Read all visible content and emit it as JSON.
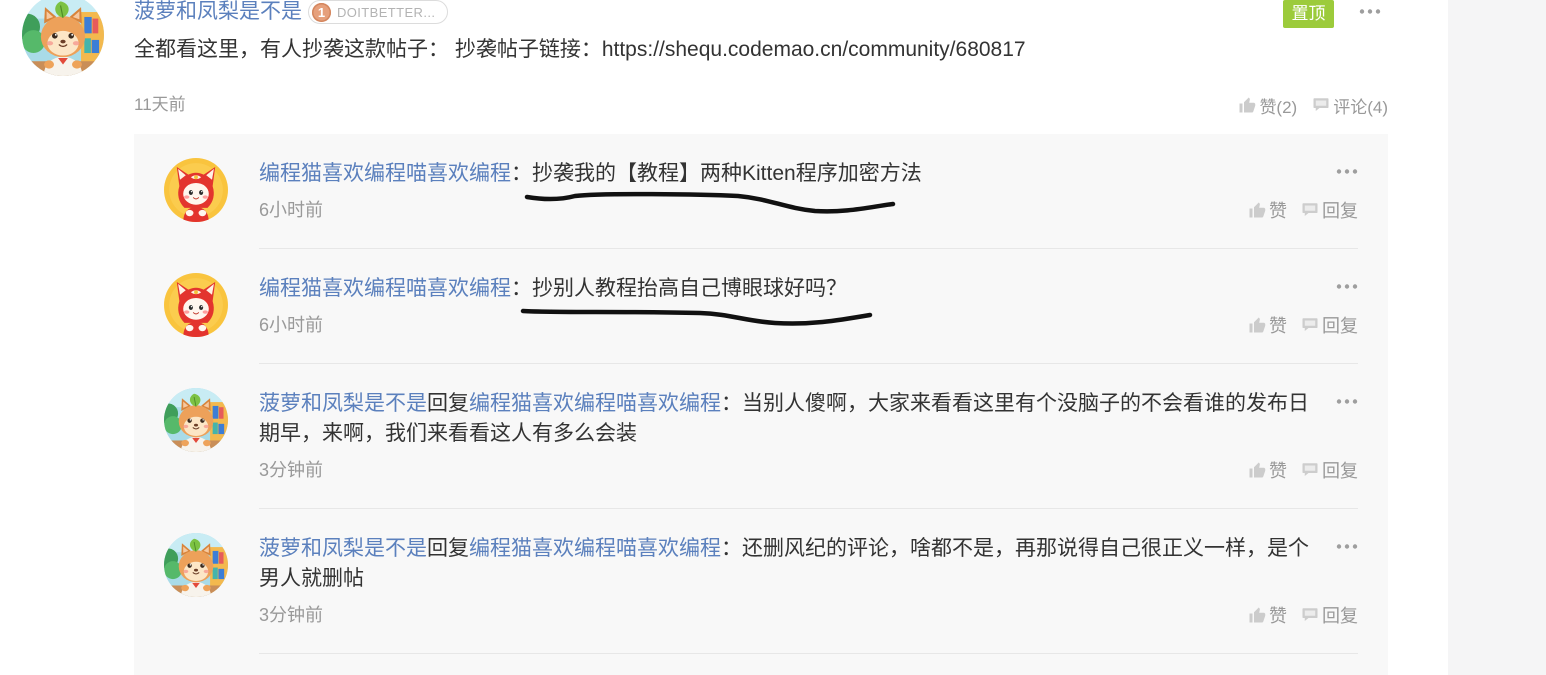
{
  "colors": {
    "link": "#5b80bd",
    "text": "#333333",
    "muted": "#999999",
    "pinned": "#9ccb3b",
    "panel": "#f8f8f8",
    "badge": "#e6a07c"
  },
  "icons": {
    "like": "thumbs-up-icon",
    "comment": "comment-bubble-icon",
    "more": "more-dots-icon",
    "level": "level-badge-icon"
  },
  "post": {
    "author": "菠萝和凤梨是不是",
    "badge": {
      "level": "1",
      "text": "DOITBETTER..."
    },
    "pinned_label": "置顶",
    "content": "全都看这里，有人抄袭这款帖子： 抄袭帖子链接：https://shequ.codemao.cn/community/680817",
    "time": "11天前",
    "like_label": "赞(2)",
    "comment_label": "评论(4)"
  },
  "comments": [
    {
      "author": "编程猫喜欢编程喵喜欢编程",
      "colon": "：",
      "text": "抄袭我的【教程】两种Kitten程序加密方法",
      "time": "6小时前",
      "like_label": "赞",
      "reply_label": "回复"
    },
    {
      "author": "编程猫喜欢编程喵喜欢编程",
      "colon": "：",
      "text": "抄别人教程抬高自己博眼球好吗？",
      "time": "6小时前",
      "like_label": "赞",
      "reply_label": "回复"
    },
    {
      "author": "菠萝和凤梨是不是",
      "reply_word": "回复",
      "reply_to": "编程猫喜欢编程喵喜欢编程",
      "colon": "：",
      "text": "当别人傻啊，大家来看看这里有个没脑子的不会看谁的发布日期早，来啊，我们来看看这人有多么会装",
      "time": "3分钟前",
      "like_label": "赞",
      "reply_label": "回复"
    },
    {
      "author": "菠萝和凤梨是不是",
      "reply_word": "回复",
      "reply_to": "编程猫喜欢编程喵喜欢编程",
      "colon": "：",
      "text": "还删风纪的评论，啥都不是，再那说得自己很正义一样，是个男人就删帖",
      "time": "3分钟前",
      "like_label": "赞",
      "reply_label": "回复"
    }
  ]
}
